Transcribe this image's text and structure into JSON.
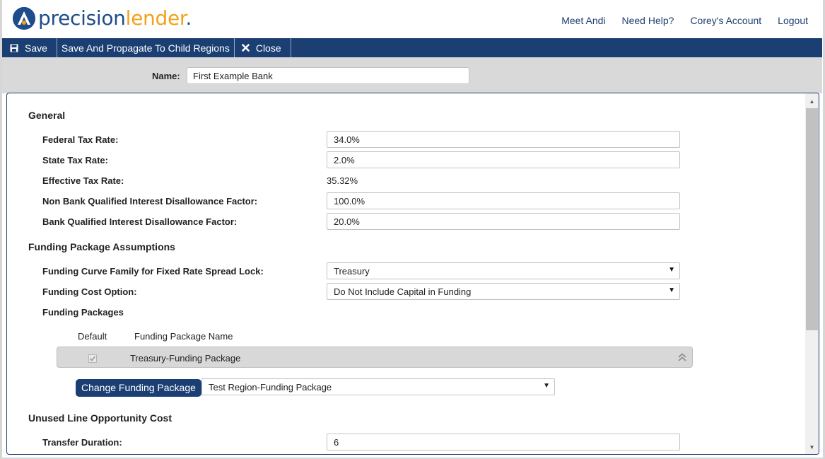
{
  "brand": {
    "text_a": "precision",
    "text_b": "lender",
    "text_c": "."
  },
  "topnav": [
    "Meet Andi",
    "Need Help?",
    "Corey's Account",
    "Logout"
  ],
  "toolbar": {
    "save": "Save",
    "propagate": "Save And Propagate To Child Regions",
    "close": "Close"
  },
  "name": {
    "label": "Name:",
    "value": "First Example Bank"
  },
  "general": {
    "title": "General",
    "federal_label": "Federal Tax Rate:",
    "federal_value": "34.0%",
    "state_label": "State Tax Rate:",
    "state_value": "2.0%",
    "effective_label": "Effective Tax Rate:",
    "effective_value": "35.32%",
    "nonbank_label": "Non Bank Qualified Interest Disallowance Factor:",
    "nonbank_value": "100.0%",
    "bank_label": "Bank Qualified Interest Disallowance Factor:",
    "bank_value": "20.0%"
  },
  "funding": {
    "title": "Funding Package Assumptions",
    "curve_label": "Funding Curve Family for Fixed Rate Spread Lock:",
    "curve_value": "Treasury",
    "cost_label": "Funding Cost Option:",
    "cost_value": "Do Not Include Capital in Funding",
    "packages_label": "Funding Packages",
    "col_default": "Default",
    "col_name": "Funding Package Name",
    "package_name": "Treasury-Funding Package",
    "change_button": "Change Funding Package",
    "change_value": "Test Region-Funding Package"
  },
  "unused": {
    "title": "Unused Line Opportunity Cost",
    "transfer_label": "Transfer Duration:",
    "transfer_value": "6"
  },
  "colors": {
    "navy": "#1b3f73",
    "brand_blue": "#1f4d8c",
    "brand_orange": "#f2a21a"
  }
}
